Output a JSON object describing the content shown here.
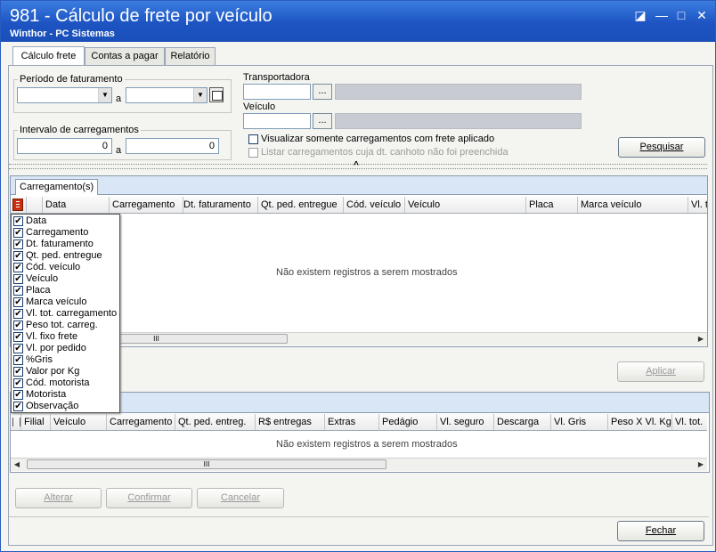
{
  "window": {
    "title": "981 - Cálculo de frete por veículo",
    "subtitle": "Winthor - PC Sistemas",
    "restore_glyph": "◪",
    "minimize_glyph": "—",
    "maximize_glyph": "□",
    "close_glyph": "✕"
  },
  "tabs": [
    "Cálculo frete",
    "Contas a pagar",
    "Relatório"
  ],
  "filters": {
    "periodo_label": "Período de faturamento",
    "periodo_sep": "a",
    "intervalo_label": "Intervalo de carregamentos",
    "intervalo_from": "0",
    "intervalo_sep": "a",
    "intervalo_to": "0",
    "transportadora_label": "Transportadora",
    "veiculo_label": "Veículo",
    "lookup_btn": "...",
    "chk_frete_aplicado": "Visualizar somente carregamentos com frete aplicado",
    "chk_canhoto": "Listar carregamentos cuja dt. canhoto não foi preenchida",
    "pesquisar": "Pesquisar",
    "splitter_glyph": "^"
  },
  "grid1": {
    "tab": "Carregamento(s)",
    "columns": [
      "Data",
      "Carregamento",
      "Dt. faturamento",
      "Qt. ped. entregue",
      "Cód. veículo",
      "Veículo",
      "Placa",
      "Marca veículo",
      "Vl. t"
    ],
    "empty": "Não existem registros a serem mostrados",
    "thumb_glyph": "III",
    "left_arrow": "◀",
    "right_arrow": "▶"
  },
  "column_menu": [
    "Data",
    "Carregamento",
    "Dt. faturamento",
    "Qt. ped. entregue",
    "Cód. veículo",
    "Veículo",
    "Placa",
    "Marca veículo",
    "Vl. tot. carregamento",
    "Peso tot. carreg.",
    "Vl. fixo frete",
    "Vl. por pedido",
    "%Gris",
    "Valor por Kg",
    "Cód. motorista",
    "Motorista",
    "Observação"
  ],
  "aplicar": "Aplicar",
  "grid2": {
    "columns": [
      "Filial",
      "Veículo",
      "Carregamento",
      "Qt. ped. entreg.",
      "R$ entregas",
      "Extras",
      "Pedágio",
      "Vl. seguro",
      "Descarga",
      "Vl. Gris",
      "Peso X Vl. Kg",
      "Vl. tot."
    ],
    "empty": "Não existem registros a serem mostrados",
    "thumb_glyph": "III",
    "left_arrow": "◀",
    "right_arrow": "▶"
  },
  "actions": {
    "alterar": "Alterar",
    "confirmar": "Confirmar",
    "cancelar": "Cancelar",
    "fechar": "Fechar"
  },
  "colors": {
    "title_bar": "#1d54c2",
    "band": "#d8e6f6"
  }
}
